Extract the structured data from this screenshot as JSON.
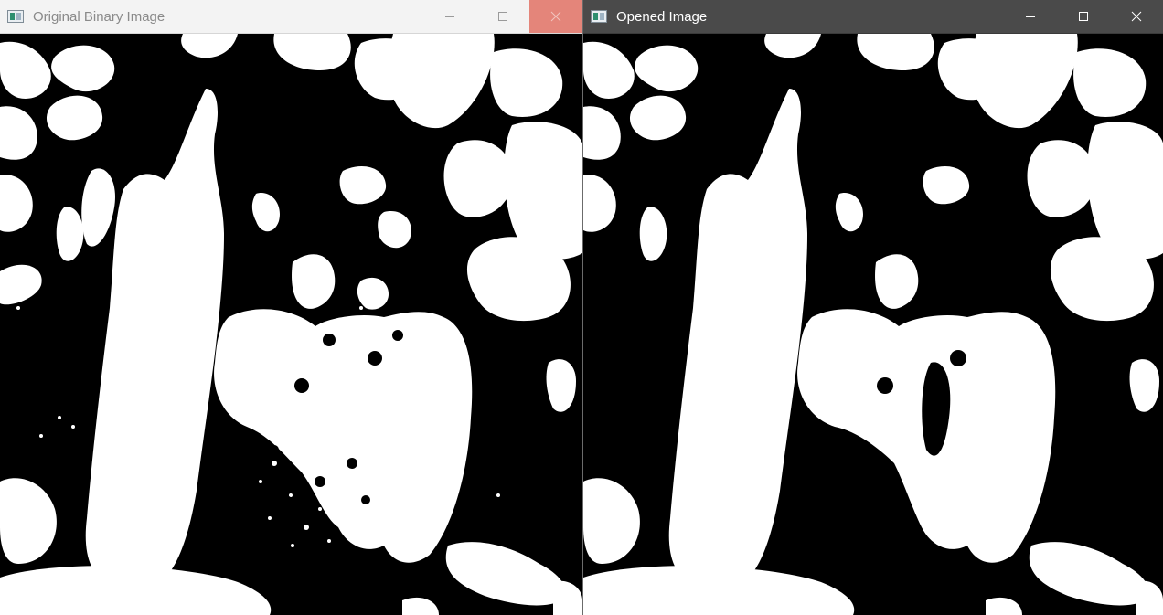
{
  "windows": {
    "left": {
      "title": "Original Binary Image",
      "state": "inactive",
      "icon": "app-image-icon",
      "controls": [
        "minimize-icon",
        "maximize-icon",
        "close-icon"
      ],
      "close_hover_color": "#e4857a"
    },
    "right": {
      "title": "Opened Image",
      "state": "active",
      "icon": "app-image-icon",
      "controls": [
        "minimize-icon",
        "maximize-icon",
        "close-icon"
      ]
    }
  },
  "colors": {
    "foreground": "#ffffff",
    "background": "#000000"
  }
}
